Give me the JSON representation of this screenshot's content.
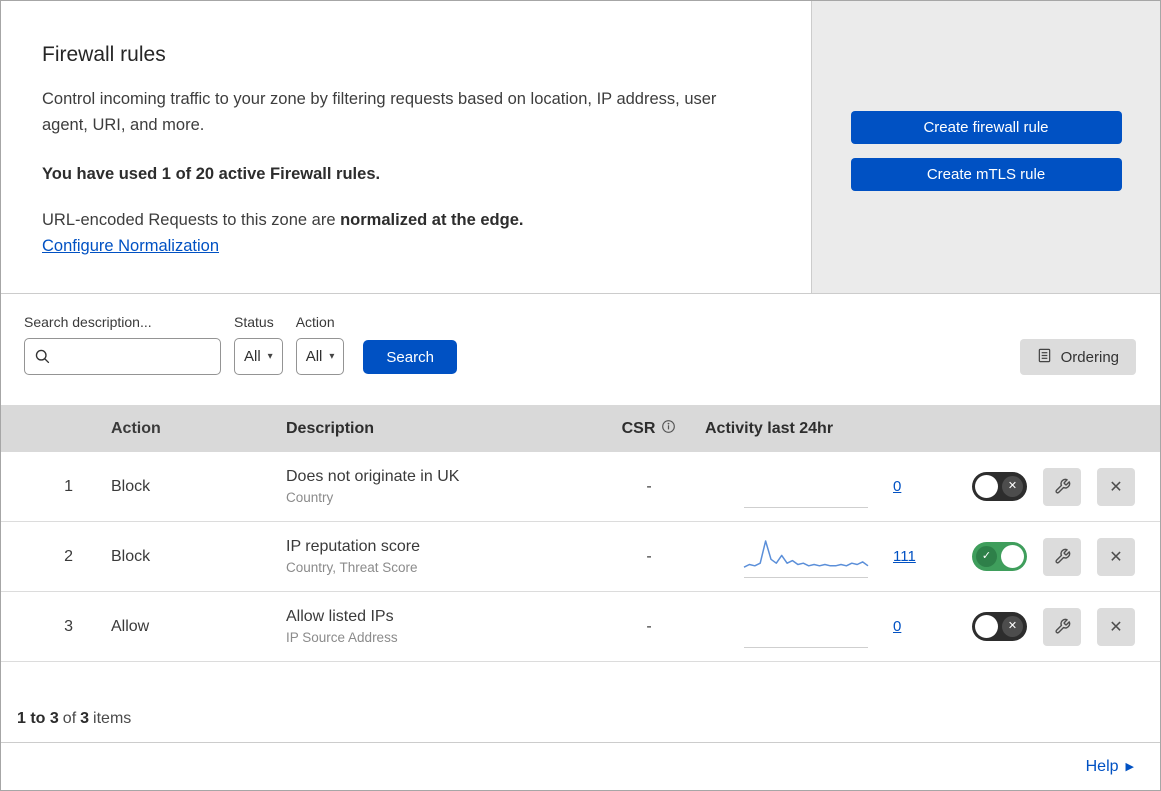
{
  "header": {
    "title": "Firewall rules",
    "description": "Control incoming traffic to your zone by filtering requests based on location, IP address, user agent, URI, and more.",
    "usage": "You have used 1 of 20 active Firewall rules.",
    "normalization_prefix": "URL-encoded Requests to this zone are ",
    "normalization_bold": "normalized at the edge.",
    "normalization_link": "Configure Normalization",
    "buttons": {
      "create_firewall": "Create firewall rule",
      "create_mtls": "Create mTLS rule"
    }
  },
  "filters": {
    "search_label": "Search description...",
    "search_value": "",
    "status_label": "Status",
    "status_value": "All",
    "action_label": "Action",
    "action_value": "All",
    "search_button": "Search",
    "ordering_button": "Ordering"
  },
  "table": {
    "headers": {
      "action": "Action",
      "description": "Description",
      "csr": "CSR",
      "activity": "Activity last 24hr"
    },
    "rows": [
      {
        "index": "1",
        "action": "Block",
        "description": "Does not originate in UK",
        "fields": "Country",
        "csr": "-",
        "activity_count": "0",
        "enabled": false
      },
      {
        "index": "2",
        "action": "Block",
        "description": "IP reputation score",
        "fields": "Country, Threat Score",
        "csr": "-",
        "activity_count": "111",
        "enabled": true,
        "sparkline": [
          6,
          8,
          7,
          9,
          26,
          12,
          9,
          15,
          9,
          11,
          8,
          9,
          7,
          8,
          7,
          8,
          7,
          7,
          8,
          7,
          9,
          8,
          10,
          7
        ]
      },
      {
        "index": "3",
        "action": "Allow",
        "description": "Allow listed IPs",
        "fields": "IP Source Address",
        "csr": "-",
        "activity_count": "0",
        "enabled": false
      }
    ]
  },
  "footer": {
    "range": "1 to 3",
    "of_label": "of",
    "total": "3",
    "items_label": "items"
  },
  "help": {
    "label": "Help"
  },
  "icons": {
    "caret_down": "▾",
    "check": "✓",
    "close": "✕",
    "help_arrow": "▶"
  },
  "colors": {
    "accent": "#0051c3",
    "panel-gray": "#ebebeb",
    "table-header": "#d9d9d9",
    "button-gray": "#dcdcdc",
    "sparkline": "#5b8fd9",
    "toggle-on": "#3f9e5c",
    "toggle-on-badge": "#2e8049",
    "toggle-off": "#2d2d2d",
    "toggle-off-badge": "#4d4d4d"
  }
}
